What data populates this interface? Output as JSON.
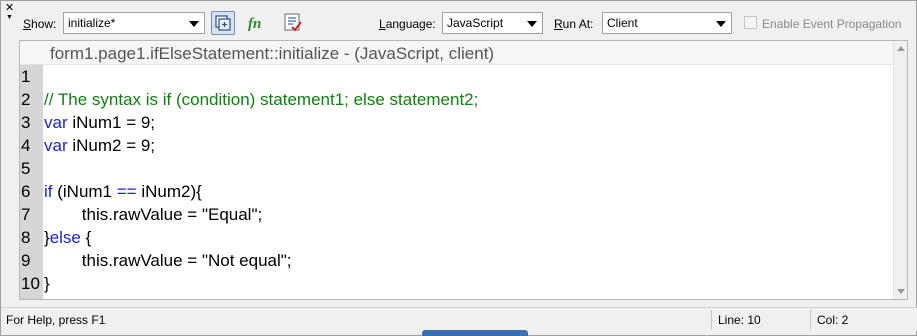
{
  "toolbar": {
    "show_label": "Show:",
    "show_value": "initialize*",
    "language_label": "Language:",
    "language_value": "JavaScript",
    "run_at_label": "Run At:",
    "run_at_value": "Client",
    "event_propagation_label": "Enable Event Propagation",
    "icons": [
      "functions-view-icon",
      "fn-icon",
      "check-script-icon"
    ]
  },
  "editor": {
    "header": "form1.page1.ifElseStatement::initialize - (JavaScript, client)",
    "lines": [
      {
        "num": "1",
        "text": ""
      },
      {
        "num": "2",
        "text": "// The syntax is if (condition) statement1; else statement2;"
      },
      {
        "num": "3",
        "text": "var iNum1 = 9;"
      },
      {
        "num": "4",
        "text": "var iNum2 = 9;"
      },
      {
        "num": "5",
        "text": ""
      },
      {
        "num": "6",
        "text": "if (iNum1 == iNum2){"
      },
      {
        "num": "7",
        "text": "        this.rawValue = \"Equal\";"
      },
      {
        "num": "8",
        "text": "}else {"
      },
      {
        "num": "9",
        "text": "        this.rawValue = \"Not equal\";"
      },
      {
        "num": "10",
        "text": "}"
      }
    ]
  },
  "status": {
    "help": "For Help, press F1",
    "line": "Line: 10",
    "col": "Col: 2"
  },
  "colors": {
    "keyword": "#1e25c8",
    "comment": "#118011",
    "gutter": "#d6d6d6"
  }
}
